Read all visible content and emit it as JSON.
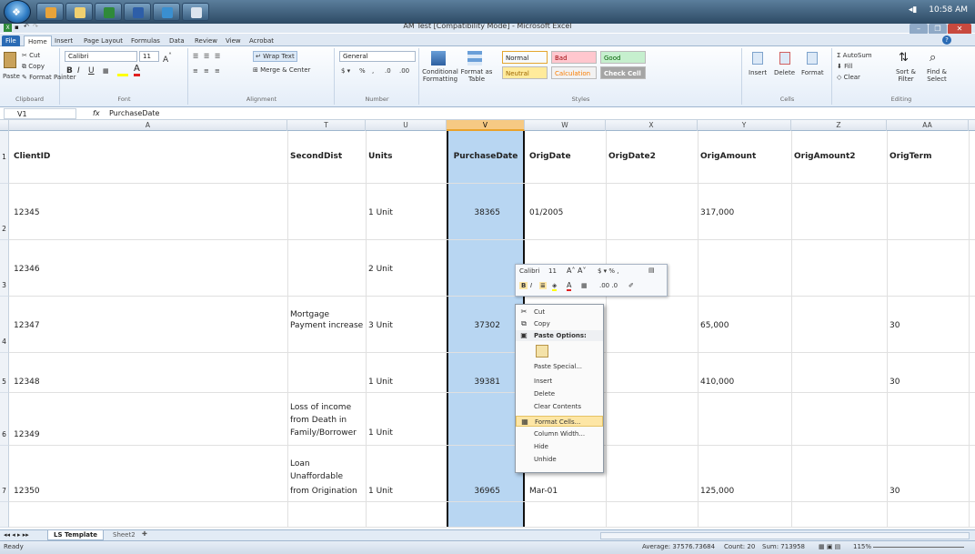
{
  "window": {
    "title": "AM Test  [Compatibility Mode]  -  Microsoft Excel",
    "clock": "10:58 AM"
  },
  "ribbon_tabs": [
    "File",
    "Home",
    "Insert",
    "Page Layout",
    "Formulas",
    "Data",
    "Review",
    "View",
    "Acrobat"
  ],
  "ribbon": {
    "clipboard": {
      "label": "Clipboard",
      "paste": "Paste",
      "cut": "Cut",
      "copy": "Copy",
      "format_painter": "Format Painter"
    },
    "font": {
      "label": "Font",
      "name": "Calibri",
      "size": "11"
    },
    "alignment": {
      "label": "Alignment",
      "wrap": "Wrap Text",
      "merge": "Merge & Center"
    },
    "number": {
      "label": "Number",
      "format": "General"
    },
    "styles": {
      "label": "Styles",
      "conditional": "Conditional Formatting",
      "format_table": "Format as Table",
      "cells": [
        {
          "name": "Normal",
          "bg": "#ffffff",
          "fg": "#000000"
        },
        {
          "name": "Bad",
          "bg": "#ffc7ce",
          "fg": "#9c0006"
        },
        {
          "name": "Good",
          "bg": "#c6efce",
          "fg": "#006100"
        },
        {
          "name": "Neutral",
          "bg": "#ffeb9c",
          "fg": "#9c6500"
        },
        {
          "name": "Calculation",
          "bg": "#f2f2f2",
          "fg": "#fa7d00"
        },
        {
          "name": "Check Cell",
          "bg": "#a5a5a5",
          "fg": "#ffffff"
        }
      ]
    },
    "cells": {
      "label": "Cells",
      "insert": "Insert",
      "delete": "Delete",
      "format": "Format"
    },
    "editing": {
      "label": "Editing",
      "autosum": "AutoSum",
      "fill": "Fill",
      "clear": "Clear",
      "sort": "Sort & Filter",
      "find": "Find & Select"
    }
  },
  "formula_bar": {
    "name_box": "V1",
    "fx": "fx",
    "content": "PurchaseDate"
  },
  "columns": [
    "A",
    "T",
    "U",
    "V",
    "W",
    "X",
    "Y",
    "Z",
    "AA"
  ],
  "header_row": {
    "num": "1",
    "cells": [
      "ClientID",
      "SecondDist",
      "Units",
      "PurchaseDate",
      "OrigDate",
      "OrigDate2",
      "OrigAmount",
      "OrigAmount2",
      "OrigTerm"
    ]
  },
  "rows": [
    {
      "num": "2",
      "client": "12345",
      "dist": [
        ""
      ],
      "units": "1 Unit",
      "purchase": "38365",
      "origdate": "01/2005",
      "amount": "317,000",
      "term": ""
    },
    {
      "num": "3",
      "client": "12346",
      "dist": [
        ""
      ],
      "units": "2 Unit",
      "purchase": "",
      "origdate": "",
      "amount": "",
      "term": ""
    },
    {
      "num": "4",
      "client": "12347",
      "dist": [
        "Mortgage",
        "Payment increase"
      ],
      "units": "3 Unit",
      "purchase": "37302",
      "origdate": "",
      "amount": "65,000",
      "term": "30"
    },
    {
      "num": "5",
      "client": "12348",
      "dist": [
        ""
      ],
      "units": "1 Unit",
      "purchase": "39381",
      "origdate": "",
      "amount": "410,000",
      "term": "30"
    },
    {
      "num": "6",
      "client": "12349",
      "dist": [
        "Loss of income",
        "from Death in",
        "Family/Borrower"
      ],
      "units": "1 Unit",
      "purchase": "",
      "origdate": "",
      "amount": "",
      "term": ""
    },
    {
      "num": "7",
      "client": "12350",
      "dist": [
        "Loan",
        "Unaffordable",
        "from Origination"
      ],
      "units": "1 Unit",
      "purchase": "36965",
      "origdate": "Mar-01",
      "amount": "125,000",
      "term": "30"
    }
  ],
  "mini_toolbar": {
    "font": "Calibri",
    "size": "11"
  },
  "context_menu": [
    "Cut",
    "Copy",
    "Paste Options:",
    "",
    "Paste Special...",
    "Insert",
    "Delete",
    "Clear Contents",
    "Format Cells...",
    "Column Width...",
    "Hide",
    "Unhide"
  ],
  "sheets": [
    "LS Template",
    "Sheet2"
  ],
  "status": {
    "ready": "Ready",
    "average": "Average: 37576.73684",
    "count": "Count: 20",
    "sum": "Sum: 713958",
    "zoom": "115%"
  }
}
